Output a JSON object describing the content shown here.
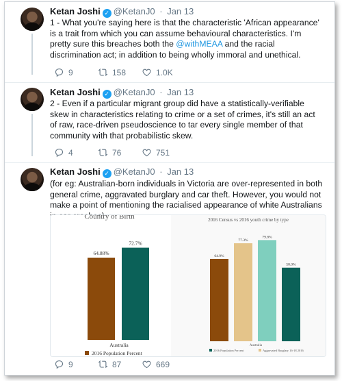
{
  "tweets": [
    {
      "name": "Ketan Joshi",
      "handle": "@KetanJ0",
      "separator": "·",
      "date": "Jan 13",
      "text_before": "1 - What you're saying here is that the characteristic 'African appearance' is a trait from which you can assume behavioural characteristics. I'm pretty sure this breaches both the ",
      "mention": "@withMEAA",
      "text_after": " and the racial discrimination act; in addition to being wholly immoral and unethical.",
      "replies": "9",
      "retweets": "158",
      "likes": "1.0K"
    },
    {
      "name": "Ketan Joshi",
      "handle": "@KetanJ0",
      "separator": "·",
      "date": "Jan 13",
      "text": "2 - Even if a particular migrant group did have a statistically-verifiable skew in characteristics relating to crime or a set of crimes, it's still an act of raw, race-driven pseudoscience to tar every single member of that community with that probabilistic skew.",
      "replies": "4",
      "retweets": "76",
      "likes": "751"
    },
    {
      "name": "Ketan Joshi",
      "handle": "@KetanJ0",
      "separator": "·",
      "date": "Jan 13",
      "text": "(for eg: Australian-born individuals in Victoria are over-represented in both general crime, aggravated burglary and car theft. However, you would not make a point of mentioning the racialised appearance of white Australians in car crashes)",
      "replies": "9",
      "retweets": "87",
      "likes": "669"
    }
  ],
  "icons": [
    "verified-badge-icon",
    "reply-icon",
    "retweet-icon",
    "like-icon"
  ],
  "colors": {
    "accent": "#1da1f2",
    "brown": "#8b4a0b",
    "teal": "#0b6158",
    "tan": "#e4c48a",
    "mint": "#7fcfbe"
  },
  "chart_data": [
    {
      "type": "bar",
      "title": "Country of Birth",
      "categories": [
        "Australia"
      ],
      "series": [
        {
          "name": "2016 Population Percent",
          "values": [
            64.88
          ],
          "label": "64.88%"
        },
        {
          "name": "",
          "values": [
            72.7
          ],
          "label": "72.7%"
        }
      ],
      "xlabel": "Australia",
      "ylim": [
        0,
        100
      ]
    },
    {
      "type": "bar",
      "title": "2016 Census vs 2016 youth crime by type",
      "categories": [
        "Australia"
      ],
      "series": [
        {
          "name": "2016 Population Percent",
          "values": [
            64.9
          ],
          "label": "64.9%"
        },
        {
          "name": "",
          "values": [
            77.3
          ],
          "label": "77.3%"
        },
        {
          "name": "Aggravated Burglary 16-18 2016",
          "values": [
            79.8
          ],
          "label": "79.8%"
        },
        {
          "name": "",
          "values": [
            58.0
          ],
          "label": "58.0%"
        }
      ],
      "xlabel": "Australia",
      "ylim": [
        0,
        100
      ]
    }
  ]
}
